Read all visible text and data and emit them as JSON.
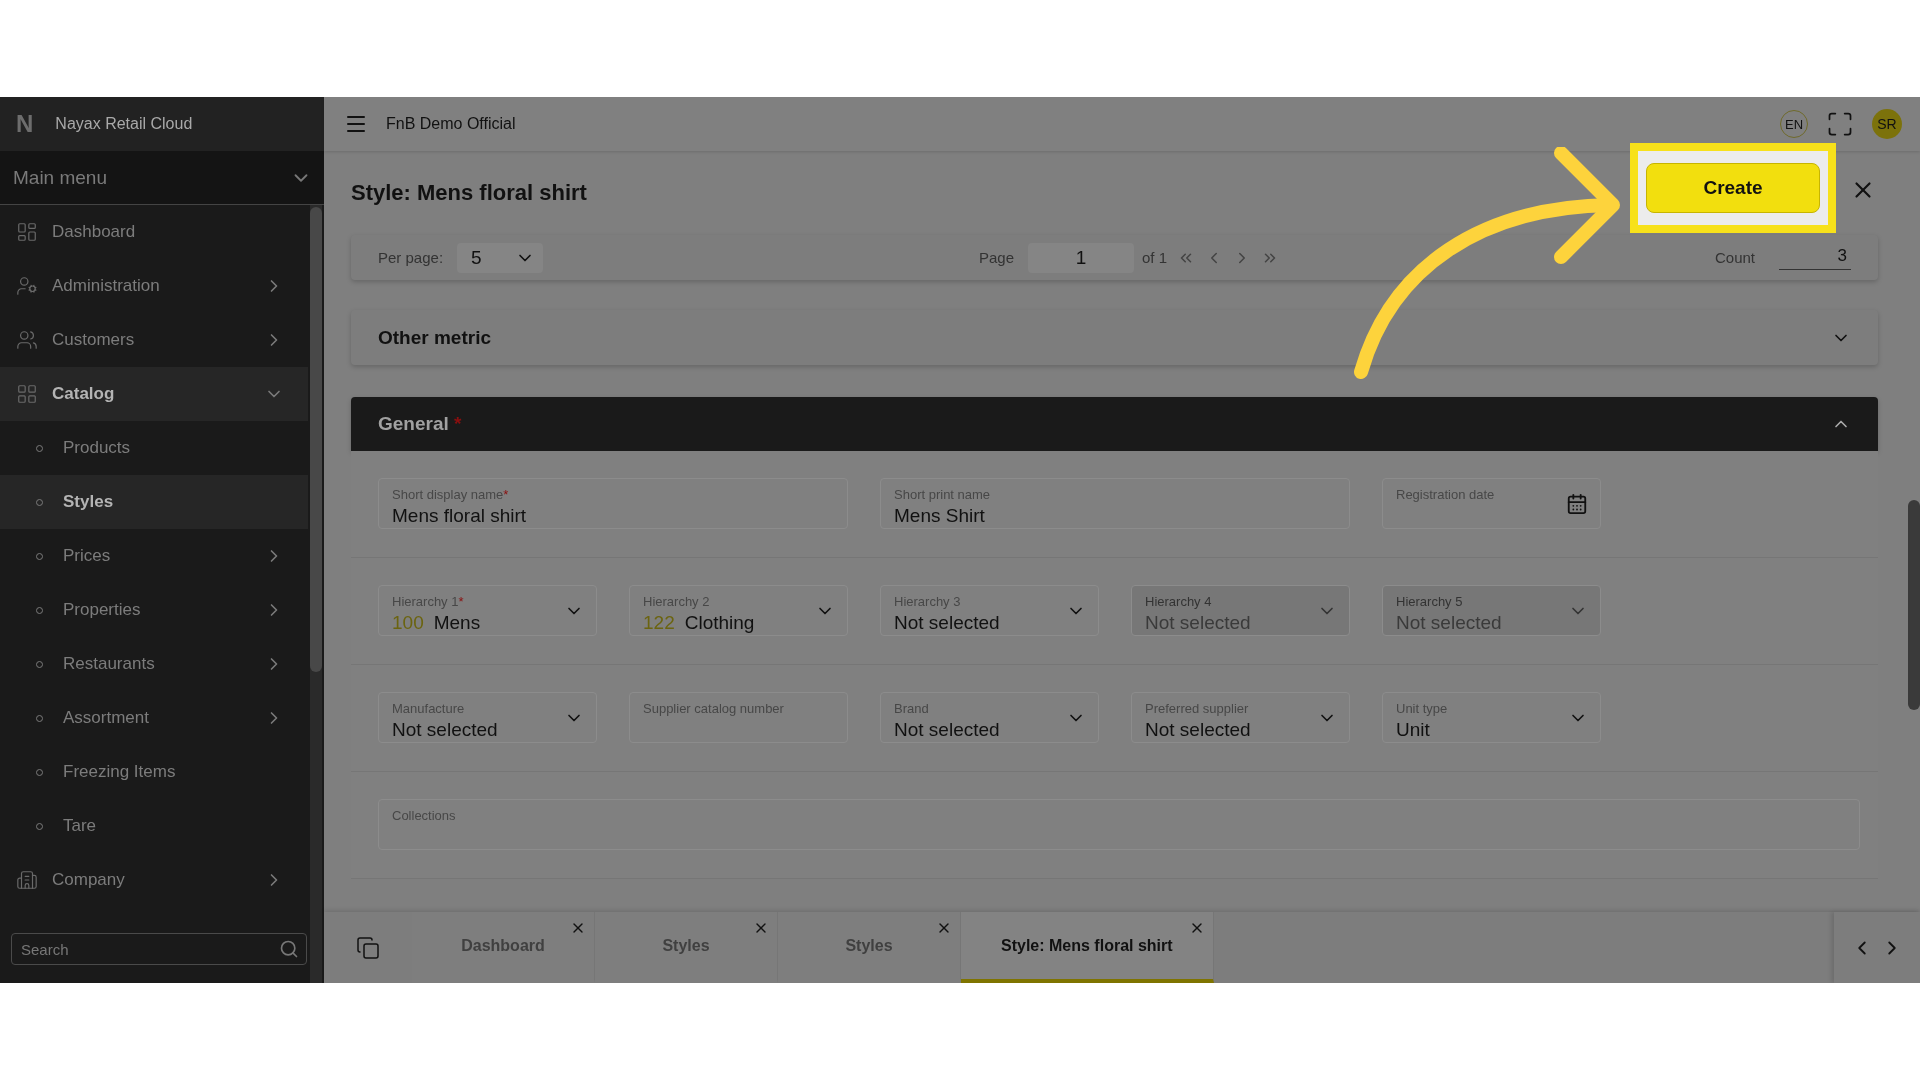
{
  "app": {
    "logo": "N",
    "name": "Nayax Retail Cloud"
  },
  "sidebar": {
    "menu_title": "Main menu",
    "search_placeholder": "Search",
    "items": [
      {
        "label": "Dashboard",
        "kind": "link",
        "selected": false
      },
      {
        "label": "Administration",
        "kind": "submenu",
        "expanded": false,
        "selected": false
      },
      {
        "label": "Customers",
        "kind": "submenu",
        "expanded": false,
        "selected": false
      },
      {
        "label": "Catalog",
        "kind": "submenu",
        "expanded": true,
        "selected": true,
        "children": [
          {
            "label": "Products",
            "kind": "link",
            "selected": false
          },
          {
            "label": "Styles",
            "kind": "link",
            "selected": true
          },
          {
            "label": "Prices",
            "kind": "submenu",
            "expanded": false,
            "selected": false
          },
          {
            "label": "Properties",
            "kind": "submenu",
            "expanded": false,
            "selected": false
          },
          {
            "label": "Restaurants",
            "kind": "submenu",
            "expanded": false,
            "selected": false
          },
          {
            "label": "Assortment",
            "kind": "submenu",
            "expanded": false,
            "selected": false
          },
          {
            "label": "Freezing Items",
            "kind": "link",
            "selected": false
          },
          {
            "label": "Tare",
            "kind": "link",
            "selected": false
          }
        ]
      },
      {
        "label": "Company",
        "kind": "submenu",
        "expanded": false,
        "selected": false
      }
    ]
  },
  "header": {
    "workspace": "FnB Demo Official",
    "language": "EN",
    "avatar": "SR"
  },
  "page": {
    "title": "Style: Mens floral shirt",
    "create_button": "Create",
    "pagination": {
      "per_page_label": "Per page:",
      "per_page": "5",
      "page_label": "Page",
      "page": "1",
      "of_label": "of 1",
      "count_label": "Count",
      "count": "3"
    },
    "collapsed_section": {
      "title": "Other metric",
      "expanded": false
    },
    "general": {
      "title": "General",
      "required_mark": "*",
      "expanded": true,
      "field_groups": [
        {
          "fields": [
            {
              "kind": "text",
              "label": "Short display name",
              "required_mark": "*",
              "value": "Mens floral shirt",
              "disabled": false
            },
            {
              "kind": "text",
              "label": "Short print name",
              "value": "Mens Shirt",
              "disabled": false
            },
            {
              "kind": "date",
              "label": "Registration date",
              "disabled": false
            }
          ]
        },
        {
          "fields": [
            {
              "kind": "select",
              "label": "Hierarchy 1",
              "required_mark": "*",
              "code": "100",
              "value": "Mens",
              "disabled": false
            },
            {
              "kind": "select",
              "label": "Hierarchy 2",
              "code": "122",
              "value": "Clothing",
              "disabled": false
            },
            {
              "kind": "select",
              "label": "Hierarchy 3",
              "value": "Not selected",
              "disabled": false
            },
            {
              "kind": "select",
              "label": "Hierarchy 4",
              "value": "Not selected",
              "disabled": true
            },
            {
              "kind": "select",
              "label": "Hierarchy 5",
              "value": "Not selected",
              "disabled": true
            }
          ]
        },
        {
          "fields": [
            {
              "kind": "select",
              "label": "Manufacture",
              "value": "Not selected",
              "disabled": false
            },
            {
              "kind": "text",
              "label": "Supplier catalog number",
              "disabled": false
            },
            {
              "kind": "select",
              "label": "Brand",
              "value": "Not selected",
              "disabled": false
            },
            {
              "kind": "select",
              "label": "Preferred supplier",
              "value": "Not selected",
              "disabled": false
            },
            {
              "kind": "select",
              "label": "Unit type",
              "value": "Unit",
              "disabled": false
            }
          ]
        },
        {
          "fields": [
            {
              "kind": "text",
              "label": "Collections",
              "disabled": false
            }
          ]
        }
      ]
    }
  },
  "tabs": [
    {
      "label": "Dashboard",
      "selected": false
    },
    {
      "label": "Styles",
      "selected": false
    },
    {
      "label": "Styles",
      "selected": false
    },
    {
      "label": "Style: Mens floral shirt",
      "selected": true
    }
  ]
}
